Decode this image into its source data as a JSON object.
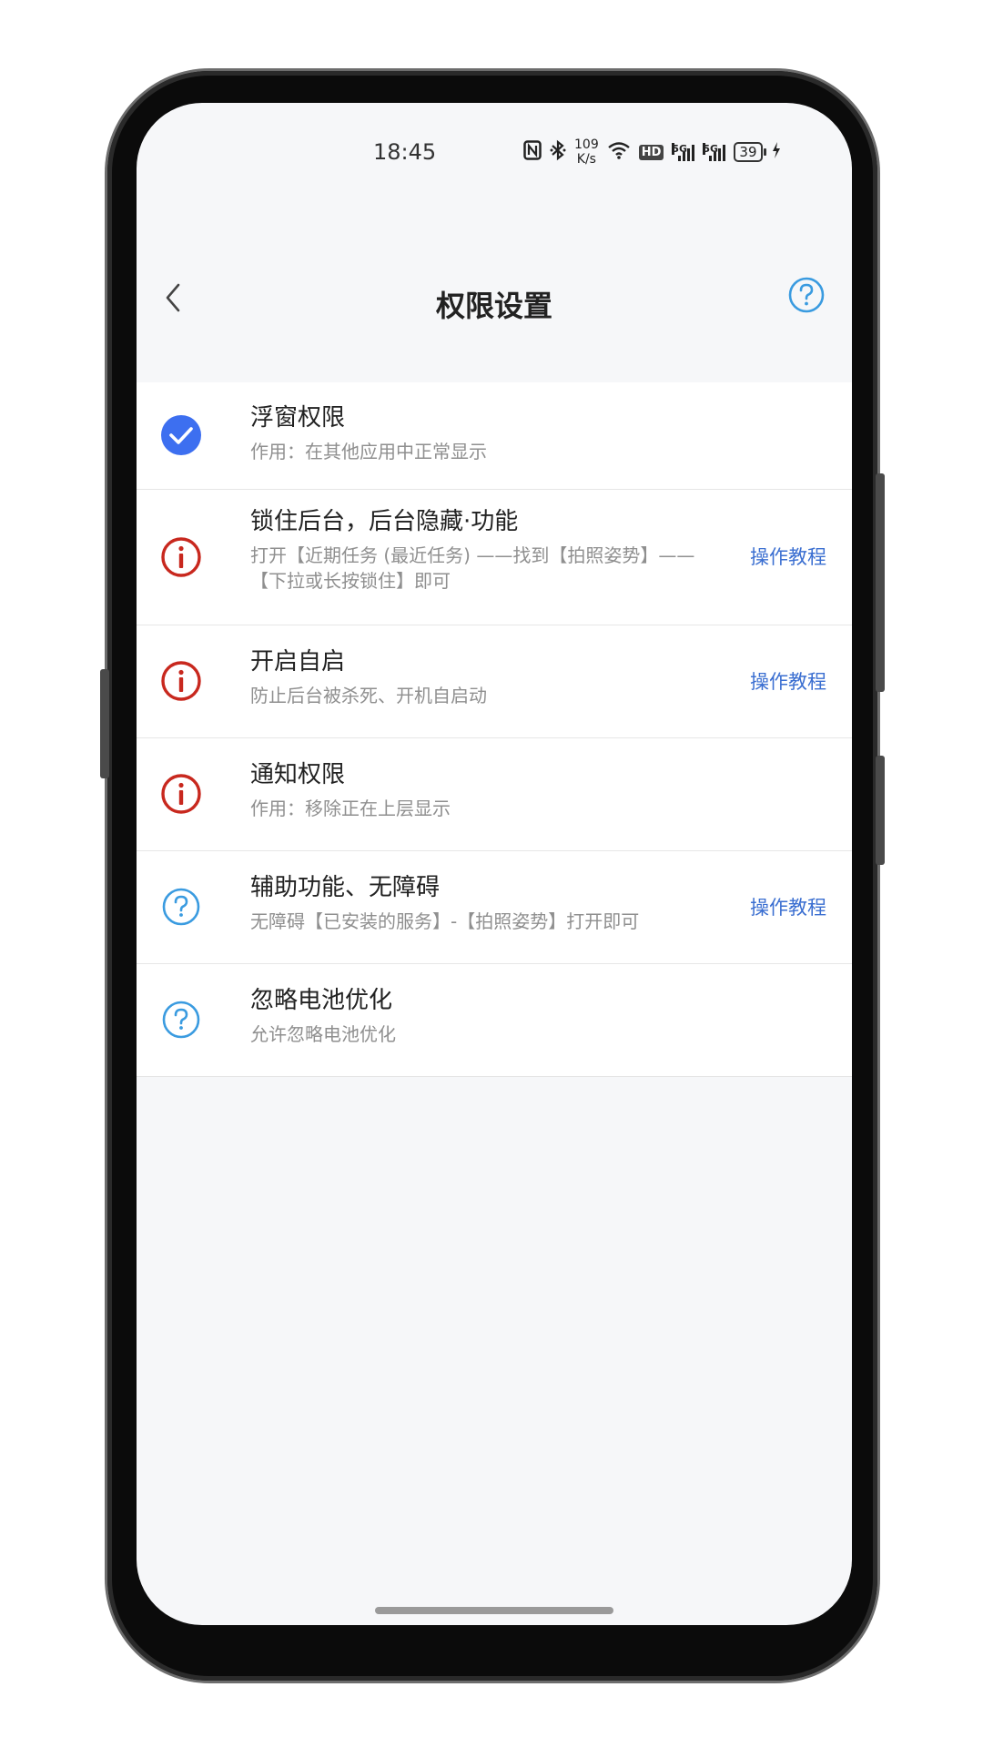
{
  "status_bar": {
    "time": "18:45",
    "net_speed_value": "109",
    "net_speed_unit": "K/s",
    "hd_label": "HD",
    "signal_label": "5G",
    "battery": "39"
  },
  "header": {
    "title": "权限设置"
  },
  "permissions": [
    {
      "title": "浮窗权限",
      "desc": "作用：在其他应用中正常显示",
      "status": "granted",
      "action": ""
    },
    {
      "title": "锁住后台，后台隐藏·功能",
      "desc": "打开【近期任务 (最近任务) ——找到【拍照姿势】——【下拉或长按锁住】即可",
      "status": "warning",
      "action": "操作教程"
    },
    {
      "title": "开启自启",
      "desc": "防止后台被杀死、开机自启动",
      "status": "warning",
      "action": "操作教程"
    },
    {
      "title": "通知权限",
      "desc": "作用：移除正在上层显示",
      "status": "warning",
      "action": ""
    },
    {
      "title": "辅助功能、无障碍",
      "desc": "无障碍【已安装的服务】-【拍照姿势】打开即可",
      "status": "unknown",
      "action": "操作教程"
    },
    {
      "title": "忽略电池优化",
      "desc": "允许忽略电池优化",
      "status": "unknown",
      "action": ""
    }
  ],
  "colors": {
    "granted": "#3d6ff0",
    "warning": "#c8281e",
    "unknown": "#3a9be0",
    "link": "#3b6fd1"
  }
}
